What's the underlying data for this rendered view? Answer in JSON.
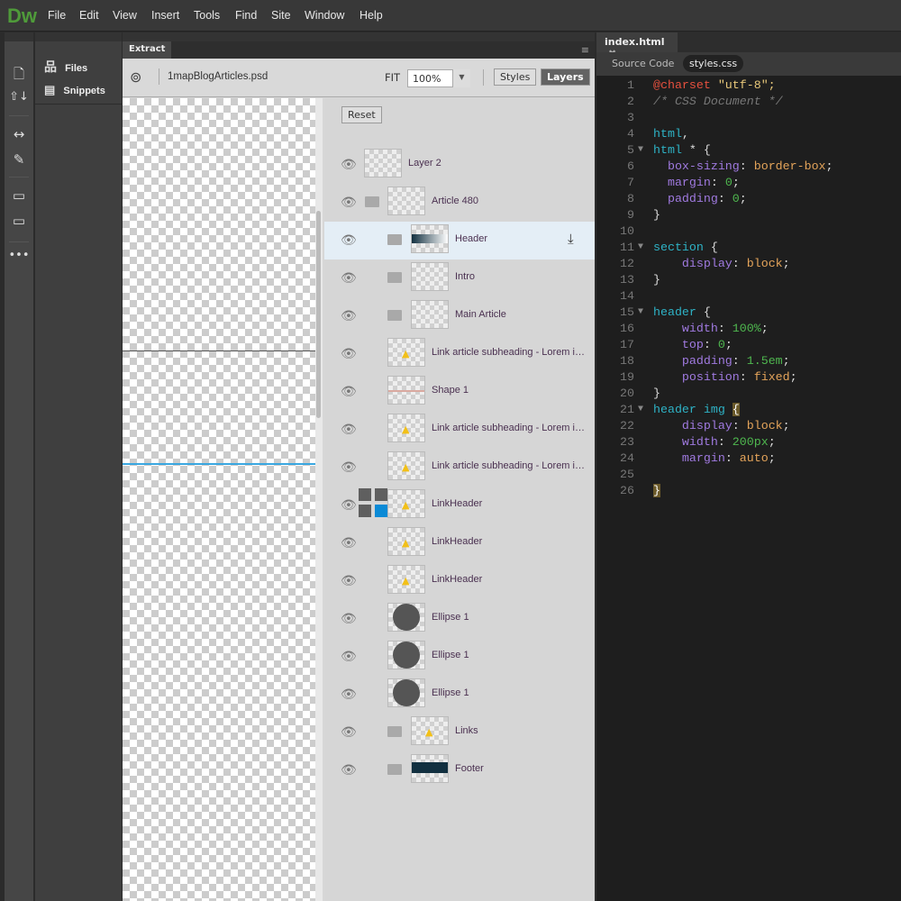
{
  "app": {
    "logo": "Dw",
    "menu": [
      "File",
      "Edit",
      "View",
      "Insert",
      "Tools",
      "Find",
      "Site",
      "Window",
      "Help"
    ]
  },
  "files_panel": {
    "items": [
      {
        "label": "Files",
        "icon": "sitemap-icon"
      },
      {
        "label": "Snippets",
        "icon": "snippets-icon"
      }
    ]
  },
  "extract": {
    "tab": "Extract",
    "file_name": "1mapBlogArticles.psd",
    "fit_label": "FIT",
    "zoom": "100%",
    "styles_label": "Styles",
    "layers_label": "Layers",
    "reset_label": "Reset",
    "layers": [
      {
        "name": "Layer 2",
        "folder": false,
        "indent": 0
      },
      {
        "name": "Article 480",
        "folder": true,
        "indent": 0
      },
      {
        "name": "Header",
        "folder": true,
        "indent": 1,
        "selected": true
      },
      {
        "name": "Intro",
        "folder": true,
        "indent": 1
      },
      {
        "name": "Main Article",
        "folder": true,
        "indent": 1
      },
      {
        "name": "Link article subheading - Lorem i…",
        "folder": false,
        "indent": 0
      },
      {
        "name": "Shape 1",
        "folder": false,
        "indent": 0
      },
      {
        "name": "Link article subheading - Lorem i…",
        "folder": false,
        "indent": 0
      },
      {
        "name": "Link article subheading - Lorem i…",
        "folder": false,
        "indent": 0
      },
      {
        "name": "LinkHeader",
        "folder": false,
        "indent": 0
      },
      {
        "name": "LinkHeader",
        "folder": false,
        "indent": 0
      },
      {
        "name": "LinkHeader",
        "folder": false,
        "indent": 0
      },
      {
        "name": "Ellipse 1",
        "folder": false,
        "indent": 0
      },
      {
        "name": "Ellipse 1",
        "folder": false,
        "indent": 0
      },
      {
        "name": "Ellipse 1",
        "folder": false,
        "indent": 0
      },
      {
        "name": "Links",
        "folder": true,
        "indent": 1
      },
      {
        "name": "Footer",
        "folder": true,
        "indent": 1
      }
    ]
  },
  "editor": {
    "tab": "index.html",
    "source_code_label": "Source Code",
    "related_file": "styles.css",
    "lines": [
      [
        [
          "a",
          "@charset"
        ],
        [
          "s",
          " \"utf-8\";"
        ]
      ],
      [
        [
          "c",
          "/* CSS Document */"
        ]
      ],
      [],
      [
        [
          "k",
          "html"
        ],
        [
          "b",
          ","
        ]
      ],
      [
        [
          "k",
          "html"
        ],
        [
          "b",
          " * {"
        ]
      ],
      [
        [
          "b",
          "  "
        ],
        [
          "p",
          "box-sizing"
        ],
        [
          "b",
          ": "
        ],
        [
          "v",
          "border-box"
        ],
        [
          "b",
          ";"
        ]
      ],
      [
        [
          "b",
          "  "
        ],
        [
          "p",
          "margin"
        ],
        [
          "b",
          ": "
        ],
        [
          "n",
          "0"
        ],
        [
          "b",
          ";"
        ]
      ],
      [
        [
          "b",
          "  "
        ],
        [
          "p",
          "padding"
        ],
        [
          "b",
          ": "
        ],
        [
          "n",
          "0"
        ],
        [
          "b",
          ";"
        ]
      ],
      [
        [
          "b",
          "}"
        ]
      ],
      [],
      [
        [
          "k",
          "section"
        ],
        [
          "b",
          " {"
        ]
      ],
      [
        [
          "b",
          "    "
        ],
        [
          "p",
          "display"
        ],
        [
          "b",
          ": "
        ],
        [
          "v",
          "block"
        ],
        [
          "b",
          ";"
        ]
      ],
      [
        [
          "b",
          "}"
        ]
      ],
      [],
      [
        [
          "k",
          "header"
        ],
        [
          "b",
          " {"
        ]
      ],
      [
        [
          "b",
          "    "
        ],
        [
          "p",
          "width"
        ],
        [
          "b",
          ": "
        ],
        [
          "n",
          "100%"
        ],
        [
          "b",
          ";"
        ]
      ],
      [
        [
          "b",
          "    "
        ],
        [
          "p",
          "top"
        ],
        [
          "b",
          ": "
        ],
        [
          "n",
          "0"
        ],
        [
          "b",
          ";"
        ]
      ],
      [
        [
          "b",
          "    "
        ],
        [
          "p",
          "padding"
        ],
        [
          "b",
          ": "
        ],
        [
          "n",
          "1.5em"
        ],
        [
          "b",
          ";"
        ]
      ],
      [
        [
          "b",
          "    "
        ],
        [
          "p",
          "position"
        ],
        [
          "b",
          ": "
        ],
        [
          "v",
          "fixed"
        ],
        [
          "b",
          ";"
        ]
      ],
      [
        [
          "b",
          "}"
        ]
      ],
      [
        [
          "k",
          "header img"
        ],
        [
          "b",
          " "
        ],
        [
          "hl",
          "{"
        ]
      ],
      [
        [
          "b",
          "    "
        ],
        [
          "p",
          "display"
        ],
        [
          "b",
          ": "
        ],
        [
          "v",
          "block"
        ],
        [
          "b",
          ";"
        ]
      ],
      [
        [
          "b",
          "    "
        ],
        [
          "p",
          "width"
        ],
        [
          "b",
          ": "
        ],
        [
          "n",
          "200px"
        ],
        [
          "b",
          ";"
        ]
      ],
      [
        [
          "b",
          "    "
        ],
        [
          "p",
          "margin"
        ],
        [
          "b",
          ": "
        ],
        [
          "v",
          "auto"
        ],
        [
          "b",
          ";"
        ]
      ],
      [],
      [
        [
          "hl",
          "}"
        ]
      ]
    ],
    "fold_lines": [
      5,
      11,
      15,
      21
    ]
  }
}
